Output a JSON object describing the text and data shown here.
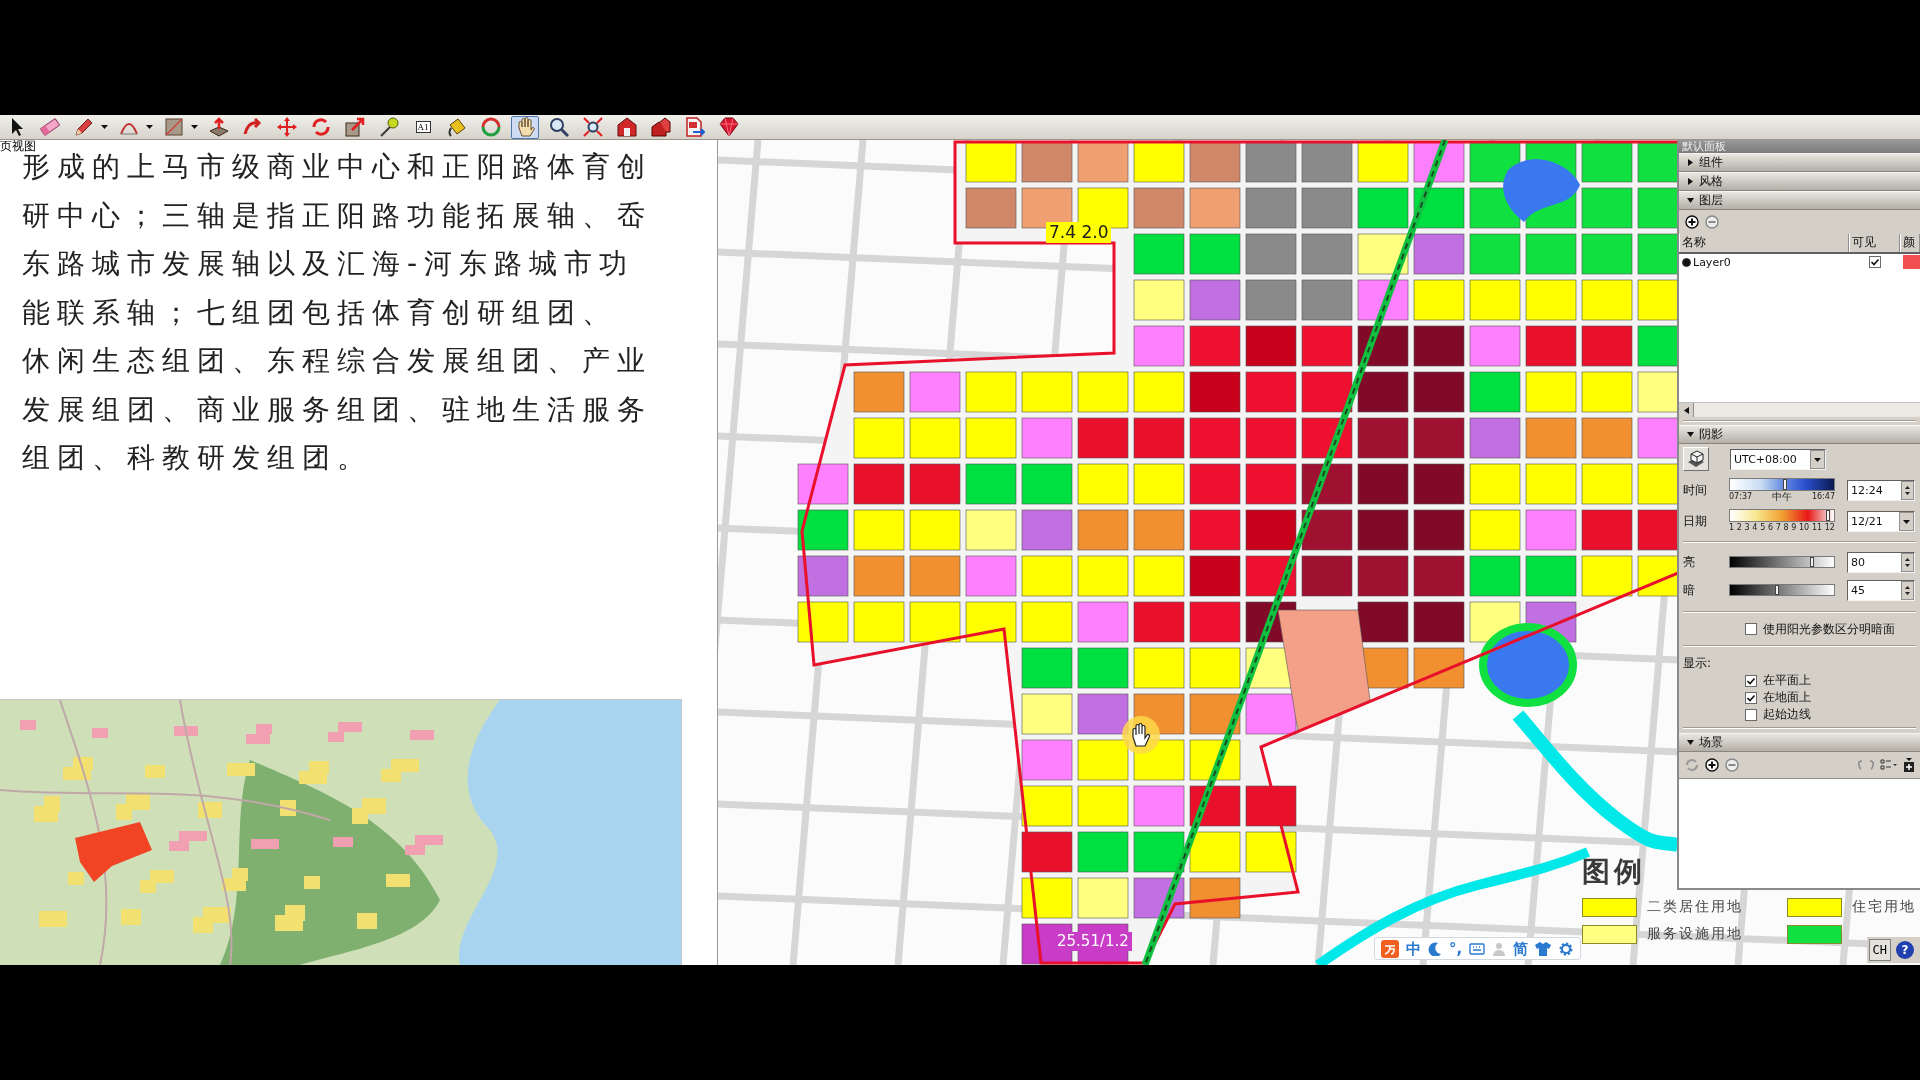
{
  "window": {
    "view_label": "页视图"
  },
  "toolbar": {
    "tools": [
      {
        "kind": "select",
        "selected": false
      },
      {
        "kind": "eraser",
        "selected": false
      },
      {
        "kind": "pencil",
        "selected": false,
        "dropdown": true
      },
      {
        "kind": "arc",
        "selected": false,
        "dropdown": true
      },
      {
        "kind": "rectangle",
        "selected": false,
        "dropdown": true
      },
      {
        "kind": "pushpull",
        "selected": false
      },
      {
        "kind": "followme",
        "selected": false
      },
      {
        "kind": "move",
        "selected": false
      },
      {
        "kind": "rotate",
        "selected": false
      },
      {
        "kind": "scale",
        "selected": false
      },
      {
        "kind": "tape",
        "selected": false
      },
      {
        "kind": "text",
        "selected": false,
        "label": "A1"
      },
      {
        "kind": "paint",
        "selected": false
      },
      {
        "kind": "orbit",
        "selected": false
      },
      {
        "kind": "pan",
        "selected": true
      },
      {
        "kind": "zoom",
        "selected": false
      },
      {
        "kind": "extents",
        "selected": false
      },
      {
        "kind": "warehouse",
        "selected": false
      },
      {
        "kind": "models",
        "selected": false
      },
      {
        "kind": "export",
        "selected": false
      },
      {
        "kind": "ruby",
        "selected": false
      }
    ]
  },
  "document": {
    "paragraph": [
      "形成的上马市级商业中心和正阳路体育创",
      "研中心；三轴是指正阳路功能拓展轴、岙",
      "东路城市发展轴以及汇海-河东路城市功",
      "能联系轴；七组团包括体育创研组团、",
      "休闲生态组团、东程综合发展组团、产业",
      "发展组团、商业服务组团、驻地生活服务",
      "组团、科教研发组团。"
    ]
  },
  "canvas": {
    "map_labels": [
      "7.4 2.0",
      "25.51/1.2"
    ],
    "legend": {
      "title": "图例",
      "items": [
        {
          "label": "二类居住用地",
          "color": "#ffff00"
        },
        {
          "label": "住宅用地",
          "color": "#ffff00"
        },
        {
          "label": "服务设施用地",
          "color": "#ffff80"
        },
        {
          "color": "#10e040"
        }
      ]
    },
    "ime_bar": {
      "items": [
        {
          "kind": "logo"
        },
        {
          "kind": "char",
          "text": "中"
        },
        {
          "kind": "moon"
        },
        {
          "kind": "char",
          "text": "°,"
        },
        {
          "kind": "keyboard"
        },
        {
          "kind": "user"
        },
        {
          "kind": "char",
          "text": "简"
        },
        {
          "kind": "shirt"
        },
        {
          "kind": "gear"
        }
      ]
    },
    "language_bar": {
      "label": "CH",
      "help": "?"
    }
  },
  "tray": {
    "title": "默认面板",
    "components": {
      "title": "组件",
      "expanded": false
    },
    "styles": {
      "title": "风格",
      "expanded": false
    },
    "layers": {
      "title": "图层",
      "expanded": true,
      "columns": [
        "名称",
        "可见",
        "颜"
      ],
      "rows": [
        {
          "name": "Layer0",
          "active": true,
          "visible": true,
          "color": "#f05050"
        }
      ]
    },
    "shadows": {
      "title": "阴影",
      "expanded": true,
      "timezone": "UTC+08:00",
      "time": {
        "label": "时间",
        "level": 0.53,
        "ticks": [
          "07:37",
          "中午",
          "16:47"
        ],
        "value": "12:24"
      },
      "date": {
        "label": "日期",
        "level": 0.96,
        "ticks": [
          "1",
          "2",
          "3",
          "4",
          "5",
          "6",
          "7",
          "8",
          "9",
          "10",
          "11",
          "12"
        ],
        "value": "12/21"
      },
      "light": {
        "label": "亮",
        "level": 0.8,
        "value": "80"
      },
      "dark": {
        "label": "暗",
        "level": 0.45,
        "value": "45"
      },
      "use_sun": {
        "label": "使用阳光参数区分明暗面",
        "checked": false
      },
      "display_label": "显示:",
      "display": [
        {
          "label": "在平面上",
          "checked": true
        },
        {
          "label": "在地面上",
          "checked": true
        },
        {
          "label": "起始边线",
          "checked": false
        }
      ]
    },
    "scenes": {
      "title": "场景",
      "expanded": true
    }
  }
}
